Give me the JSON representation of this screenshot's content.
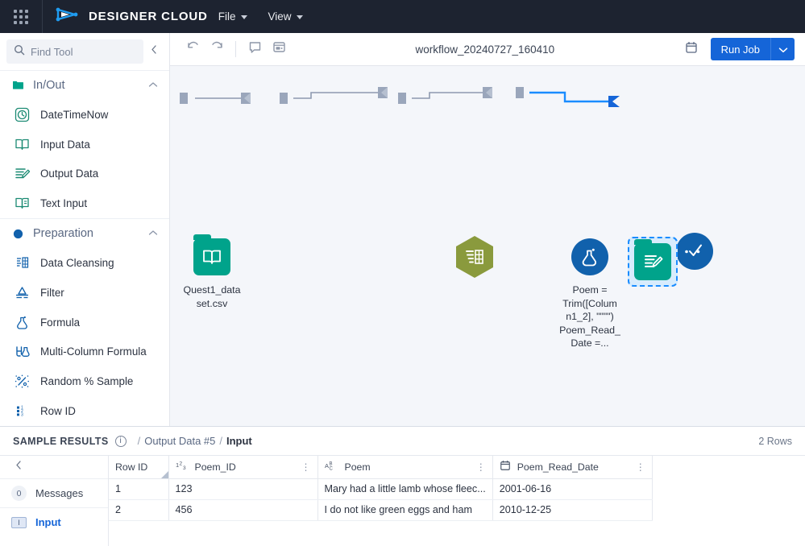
{
  "topbar": {
    "grid_icon": "apps-grid-icon",
    "logo_icon": "designer-cloud-logo",
    "brand": "DESIGNER CLOUD",
    "menus": [
      {
        "label": "File",
        "icon": "chevron-down-icon"
      },
      {
        "label": "View",
        "icon": "chevron-down-icon"
      }
    ]
  },
  "sidebar": {
    "search": {
      "placeholder": "Find Tool",
      "value": "",
      "icon": "search-icon"
    },
    "collapse_icon": "chevron-left-icon",
    "categories": [
      {
        "label": "In/Out",
        "marker_color": "#00a38b",
        "marker_shape": "folder",
        "chevron": "chevron-up-icon",
        "tools": [
          {
            "label": "DateTimeNow",
            "icon": "datetimenow-icon"
          },
          {
            "label": "Input Data",
            "icon": "input-data-icon"
          },
          {
            "label": "Output Data",
            "icon": "output-data-icon"
          },
          {
            "label": "Text Input",
            "icon": "text-input-icon"
          }
        ]
      },
      {
        "label": "Preparation",
        "marker_color": "#1161ac",
        "marker_shape": "circle",
        "chevron": "chevron-up-icon",
        "tools": [
          {
            "label": "Data Cleansing",
            "icon": "data-cleansing-icon"
          },
          {
            "label": "Filter",
            "icon": "filter-icon"
          },
          {
            "label": "Formula",
            "icon": "formula-icon"
          },
          {
            "label": "Multi-Column Formula",
            "icon": "multi-column-formula-icon"
          },
          {
            "label": "Random % Sample",
            "icon": "random-sample-icon"
          },
          {
            "label": "Row ID",
            "icon": "row-id-icon"
          }
        ]
      }
    ]
  },
  "toolbar": {
    "undo_icon": "undo-icon",
    "redo_icon": "redo-icon",
    "comment_icon": "comment-icon",
    "panel_icon": "panel-layout-icon",
    "workflow_title": "workflow_20240727_160410",
    "schedule_icon": "calendar-icon",
    "run_label": "Run Job",
    "run_caret_icon": "chevron-down-icon"
  },
  "canvas": {
    "nodes": [
      {
        "id": "input-data-node",
        "icon": "input-data-icon",
        "shape": "rounded-square",
        "color": "#00a38b",
        "label": "Quest1_data\nset.csv",
        "selected": false
      },
      {
        "id": "data-cleansing-node",
        "icon": "data-cleansing-icon",
        "shape": "hexagon",
        "color": "#8a9a3d",
        "label": "",
        "selected": false
      },
      {
        "id": "formula-node",
        "icon": "formula-icon",
        "shape": "circle",
        "color": "#1161ac",
        "label": "Poem =\nTrim([Colum\nn1_2], \"\"\"\")\nPoem_Read_\nDate =...",
        "selected": false
      },
      {
        "id": "select-node",
        "icon": "check-data-icon",
        "shape": "circle",
        "color": "#1161ac",
        "label": "",
        "selected": false
      },
      {
        "id": "output-data-node",
        "icon": "output-data-icon",
        "shape": "rounded-square",
        "color": "#00a38b",
        "label": "",
        "selected": true
      }
    ],
    "connector_color": "#8d99b0",
    "selected_connector_color": "#1a8cff"
  },
  "results": {
    "title": "SAMPLE RESULTS",
    "info_icon": "info-icon",
    "breadcrumb": [
      {
        "label": "Output Data #5",
        "active": false
      },
      {
        "label": "Input",
        "active": true
      }
    ],
    "rows_count": "2 Rows",
    "side_collapse_icon": "chevron-left-icon",
    "tabs": [
      {
        "label": "Messages",
        "badge": "0",
        "badge_type": "count",
        "active": false
      },
      {
        "label": "Input",
        "badge": "I",
        "badge_type": "anchor",
        "active": true
      }
    ],
    "table": {
      "columns": [
        {
          "label": "Row ID",
          "type_icon": "",
          "sorted": true,
          "kebab": false
        },
        {
          "label": "Poem_ID",
          "type_icon": "1²₃",
          "sorted": false,
          "kebab": true
        },
        {
          "label": "Poem",
          "type_icon": "AᴮC",
          "sorted": false,
          "kebab": true
        },
        {
          "label": "Poem_Read_Date",
          "type_icon": "calendar-icon",
          "sorted": false,
          "kebab": true
        }
      ],
      "rows": [
        [
          "1",
          "123",
          "Mary had a little lamb whose fleec...",
          "2001-06-16"
        ],
        [
          "2",
          "456",
          "I do not like green eggs and ham",
          "2010-12-25"
        ]
      ]
    }
  }
}
